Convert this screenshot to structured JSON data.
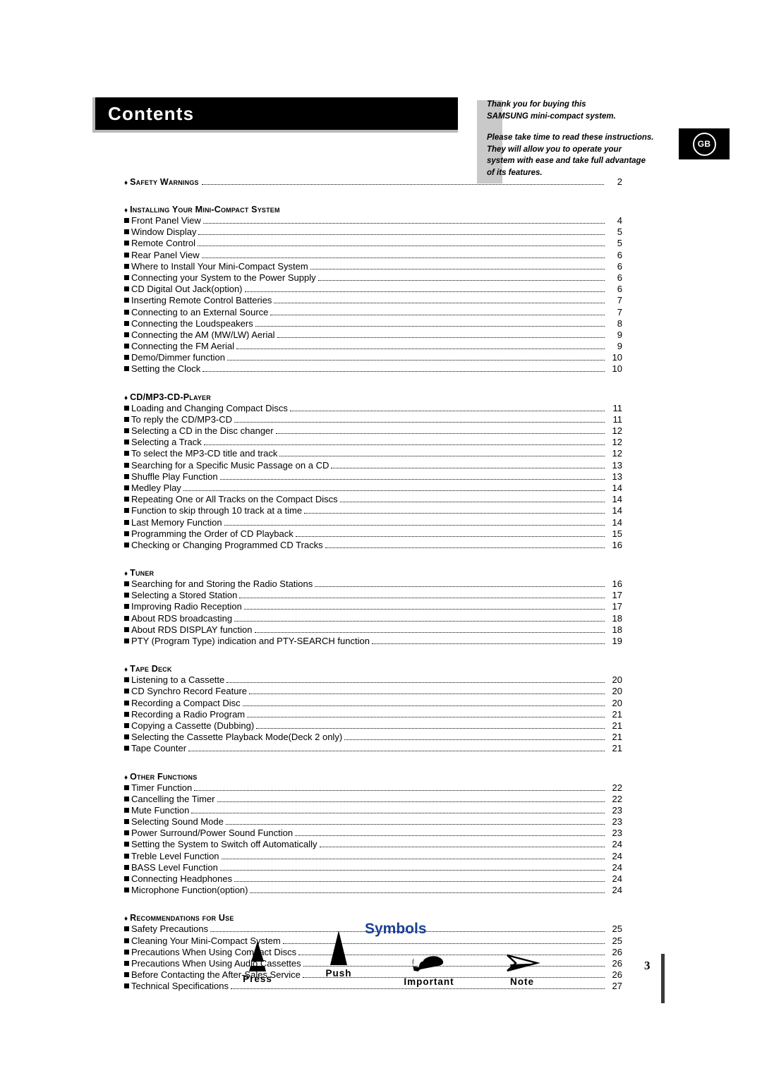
{
  "header": {
    "title": "Contents"
  },
  "intro": {
    "para1_line1": "Thank you for buying this",
    "para1_line2": "SAMSUNG mini-compact system.",
    "para2_line1": "Please take time to read these instructions.",
    "para2_line2": "They will allow you to operate your",
    "para2_line3": "system with ease and take full advantage",
    "para2_line4": "of its features."
  },
  "region_badge": {
    "code": "GB"
  },
  "toc": {
    "sections": [
      {
        "title": "Safety Warnings",
        "page": "2",
        "has_page": true,
        "items": []
      },
      {
        "title": "Installing Your Mini-Compact System",
        "page": "",
        "has_page": false,
        "items": [
          {
            "label": "Front Panel View",
            "page": "4"
          },
          {
            "label": "Window Display",
            "page": "5"
          },
          {
            "label": "Remote Control",
            "page": "5"
          },
          {
            "label": "Rear Panel View",
            "page": "6"
          },
          {
            "label": "Where to Install Your Mini-Compact System",
            "page": "6"
          },
          {
            "label": "Connecting your System to the Power Supply",
            "page": "6"
          },
          {
            "label": "CD Digital Out Jack(option)",
            "page": "6"
          },
          {
            "label": "Inserting Remote Control Batteries",
            "page": "7"
          },
          {
            "label": "Connecting to an External Source",
            "page": "7"
          },
          {
            "label": "Connecting the Loudspeakers",
            "page": "8"
          },
          {
            "label": "Connecting the AM (MW/LW) Aerial",
            "page": "9"
          },
          {
            "label": "Connecting the FM Aerial",
            "page": "9"
          },
          {
            "label": "Demo/Dimmer function",
            "page": "10"
          },
          {
            "label": "Setting the Clock",
            "page": "10"
          }
        ]
      },
      {
        "title": "CD/MP3-CD-Player",
        "page": "",
        "has_page": false,
        "items": [
          {
            "label": "Loading and Changing Compact Discs",
            "page": "11"
          },
          {
            "label": "To reply the CD/MP3-CD",
            "page": "11"
          },
          {
            "label": "Selecting a CD in the Disc changer",
            "page": "12"
          },
          {
            "label": "Selecting a Track",
            "page": "12"
          },
          {
            "label": "To select the MP3-CD title and track",
            "page": "12"
          },
          {
            "label": "Searching for a Specific Music Passage on a CD",
            "page": "13"
          },
          {
            "label": "Shuffle Play Function",
            "page": "13"
          },
          {
            "label": "Medley Play",
            "page": "14"
          },
          {
            "label": "Repeating One or All Tracks on the Compact Discs",
            "page": "14"
          },
          {
            "label": "Function to skip through 10 track at a time",
            "page": "14"
          },
          {
            "label": "Last Memory Function",
            "page": "14"
          },
          {
            "label": "Programming the Order of CD Playback",
            "page": "15"
          },
          {
            "label": "Checking or Changing Programmed CD Tracks",
            "page": "16"
          }
        ]
      },
      {
        "title": "Tuner",
        "page": "",
        "has_page": false,
        "items": [
          {
            "label": "Searching for and Storing the Radio Stations",
            "page": "16"
          },
          {
            "label": "Selecting a Stored Station",
            "page": "17"
          },
          {
            "label": "Improving Radio Reception",
            "page": "17"
          },
          {
            "label": "About RDS broadcasting",
            "page": "18"
          },
          {
            "label": "About RDS DISPLAY function",
            "page": "18"
          },
          {
            "label": "PTY (Program Type) indication and PTY-SEARCH function",
            "page": "19"
          }
        ]
      },
      {
        "title": "Tape Deck",
        "page": "",
        "has_page": false,
        "items": [
          {
            "label": "Listening to a Cassette",
            "page": "20"
          },
          {
            "label": "CD Synchro Record Feature",
            "page": "20"
          },
          {
            "label": "Recording a Compact Disc",
            "page": "20"
          },
          {
            "label": "Recording a Radio Program",
            "page": "21"
          },
          {
            "label": "Copying a Cassette (Dubbing)",
            "page": "21"
          },
          {
            "label": "Selecting the Cassette Playback Mode(Deck 2 only)",
            "page": "21"
          },
          {
            "label": "Tape Counter",
            "page": "21"
          }
        ]
      },
      {
        "title": "Other Functions",
        "page": "",
        "has_page": false,
        "items": [
          {
            "label": "Timer Function",
            "page": "22"
          },
          {
            "label": "Cancelling the Timer",
            "page": "22"
          },
          {
            "label": "Mute Function",
            "page": "23"
          },
          {
            "label": "Selecting Sound  Mode",
            "page": "23"
          },
          {
            "label": "Power Surround/Power Sound Function",
            "page": "23"
          },
          {
            "label": "Setting the System to Switch off Automatically",
            "page": "24"
          },
          {
            "label": "Treble Level Function",
            "page": "24"
          },
          {
            "label": "BASS Level Function",
            "page": "24"
          },
          {
            "label": "Connecting Headphones",
            "page": "24"
          },
          {
            "label": "Microphone Function(option)",
            "page": "24"
          }
        ]
      },
      {
        "title": "Recommendations for Use",
        "page": "",
        "has_page": false,
        "items": [
          {
            "label": "Safety Precautions",
            "page": "25"
          },
          {
            "label": "Cleaning Your Mini-Compact System",
            "page": "25"
          },
          {
            "label": "Precautions When Using Compact Discs",
            "page": "26"
          },
          {
            "label": "Precautions When Using Audio Cassettes",
            "page": "26"
          },
          {
            "label": "Before Contacting the After-Sales Service",
            "page": "26"
          },
          {
            "label": "Technical Specifications",
            "page": "27"
          }
        ]
      }
    ]
  },
  "symbols": {
    "title": "Symbols",
    "title_color": "#1c3f94",
    "items": [
      {
        "icon": "press-triangle-icon",
        "label": "Press"
      },
      {
        "icon": "push-triangle-icon",
        "label": "Push"
      },
      {
        "icon": "pointing-hand-icon",
        "label": "Important"
      },
      {
        "icon": "arrow-note-icon",
        "label": "Note"
      }
    ]
  },
  "footer": {
    "page_number": "3"
  }
}
